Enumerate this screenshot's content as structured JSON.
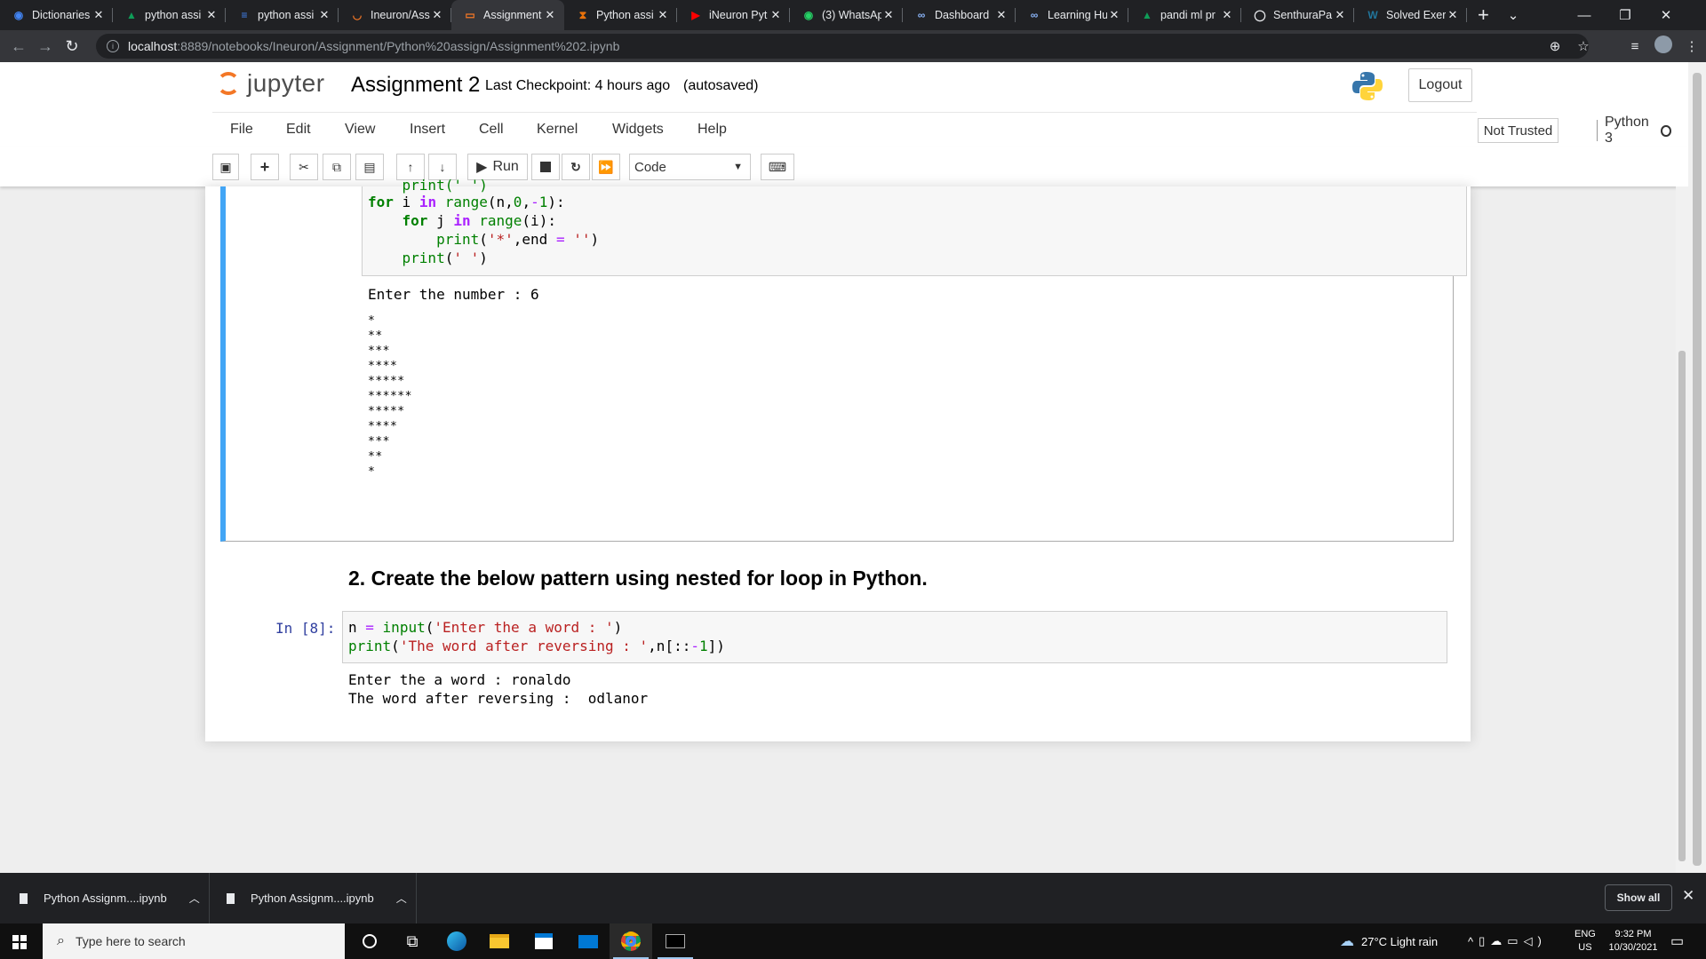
{
  "browser": {
    "tabs": [
      {
        "title": "Dictionaries",
        "color": "#4285f4",
        "glyph": "◉"
      },
      {
        "title": "python assi",
        "color": "#0f9d58",
        "glyph": "▲"
      },
      {
        "title": "python assi",
        "color": "#4285f4",
        "glyph": "≡"
      },
      {
        "title": "Ineuron/Ass",
        "color": "#f37726",
        "glyph": "◡"
      },
      {
        "title": "Assignment",
        "color": "#f37726",
        "glyph": "▭"
      },
      {
        "title": "Python assi",
        "color": "#e8710a",
        "glyph": "⧗"
      },
      {
        "title": "iNeuron Pyt",
        "color": "#ff0000",
        "glyph": "▶"
      },
      {
        "title": "(3) WhatsAp",
        "color": "#25d366",
        "glyph": "◉"
      },
      {
        "title": "Dashboard",
        "color": "#8ab4f8",
        "glyph": "∞"
      },
      {
        "title": "Learning Hu",
        "color": "#8ab4f8",
        "glyph": "∞"
      },
      {
        "title": "pandi ml pr",
        "color": "#0f9d58",
        "glyph": "▲"
      },
      {
        "title": "SenthuraPa",
        "color": "#e8eaed",
        "glyph": "◯"
      },
      {
        "title": "Solved Exer",
        "color": "#21759b",
        "glyph": "W"
      }
    ],
    "active_tab_index": 4,
    "url_host": "localhost",
    "url_path": ":8889/notebooks/Ineuron/Assignment/Python%20assign/Assignment%202.ipynb"
  },
  "jupyter": {
    "logo_text": "jupyter",
    "notebook_name": "Assignment 2",
    "checkpoint": "Last Checkpoint: 4 hours ago",
    "autosaved": "(autosaved)",
    "logout_label": "Logout",
    "menu": [
      "File",
      "Edit",
      "View",
      "Insert",
      "Cell",
      "Kernel",
      "Widgets",
      "Help"
    ],
    "trust_label": "Not Trusted",
    "kernel_name": "Python 3",
    "toolbar": {
      "run_label": "Run",
      "cell_type": "Code"
    }
  },
  "cells": {
    "cell1": {
      "code_lines": [
        "    print(' ')",
        "for i in range(n,0,-1):",
        "    for j in range(i):",
        "        print('*',end = '')",
        "    print(' ')"
      ],
      "output_prompt_line": "Enter the number : 6",
      "star_lines": [
        "*",
        "**",
        "***",
        "****",
        "*****",
        "******",
        "*****",
        "****",
        "***",
        "**",
        "*"
      ]
    },
    "markdown2": "2. Create the below pattern using nested for loop in Python.",
    "cell2": {
      "prompt": "In [8]:",
      "code_lines": [
        "n = input('Enter the a word : ')",
        "print('The word after reversing : ',n[::-1])"
      ],
      "output_lines": [
        "Enter the a word : ronaldo",
        "The word after reversing :  odlanor"
      ]
    }
  },
  "downloads": {
    "items": [
      "Python Assignm....ipynb",
      "Python Assignm....ipynb"
    ],
    "show_all_label": "Show all"
  },
  "taskbar": {
    "search_placeholder": "Type here to search",
    "weather": "27°C  Light rain",
    "lang": "ENG",
    "region": "US",
    "time": "9:32 PM",
    "date": "10/30/2021"
  }
}
